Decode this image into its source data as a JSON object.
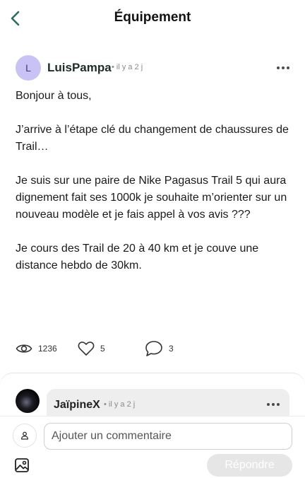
{
  "header": {
    "title": "Équipement"
  },
  "post": {
    "author_initial": "L",
    "author_name": "LuisPampa",
    "author_meta": "• il y a 2 j",
    "paragraphs": [
      "Bonjour à tous,",
      "J’arrive à l’étape clé du changement de chaussures de Trail…",
      "Je suis sur une paire de Nike Pagasus Trail 5 qui aura dignement fait ses 1000k je souhaite m’orienter sur un nouveau modèle et je fais appel à vos avis ???",
      "Je cours des Trail de 20 à 40 km et je couve une distance hebdo de 30km."
    ],
    "stats": {
      "views": "1236",
      "likes": "5",
      "comments": "3"
    }
  },
  "comment": {
    "author_name": "JaïpineX",
    "author_meta": "• il y a 2 j"
  },
  "compose": {
    "placeholder": "Ajouter un commentaire",
    "reply_label": "Répondre"
  },
  "colors": {
    "accent": "#2f6b5f",
    "avatar_bg": "#c9c3f5",
    "reply_disabled": "#e6e6e6"
  },
  "icons": [
    "back-arrow-icon",
    "more-dots-icon",
    "eye-icon",
    "heart-icon",
    "comment-bubble-icon",
    "user-icon",
    "image-icon"
  ]
}
